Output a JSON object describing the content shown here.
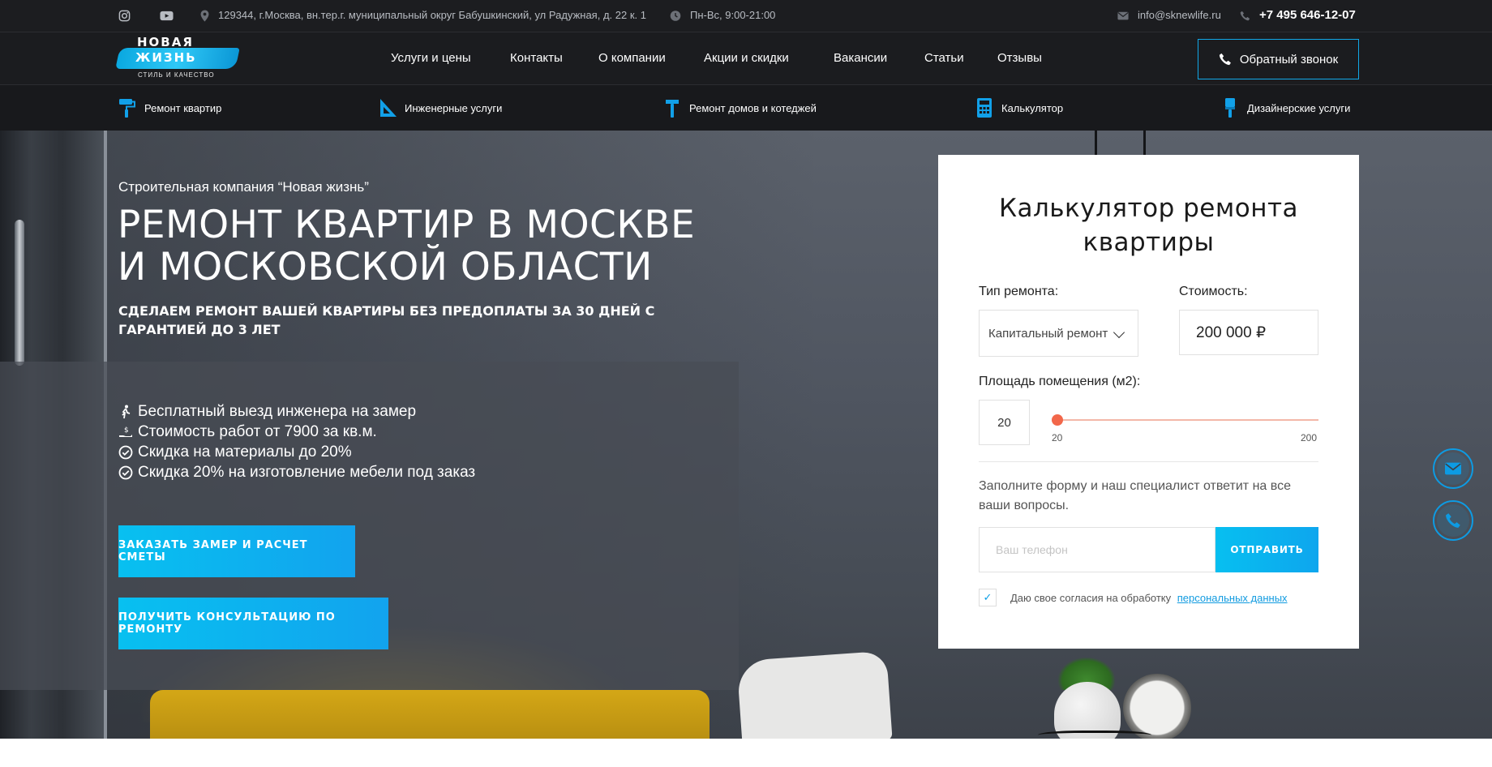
{
  "topbar": {
    "address": "129344, г.Москва, вн.тер.г. муниципальный округ Бабушкинский, ул Радужная, д. 22 к. 1",
    "hours": "Пн-Вс, 9:00-21:00",
    "email": "info@sknewlife.ru",
    "phone": "+7 495 646-12-07",
    "icons": [
      "instagram-icon",
      "youtube-icon",
      "location-icon",
      "clock-icon",
      "mail-icon",
      "phone-icon"
    ]
  },
  "logo": {
    "line1": "НОВАЯ",
    "line2": "ЖИЗНЬ",
    "tagline": "СТИЛЬ И КАЧЕСТВО"
  },
  "nav": {
    "items": [
      "Услуги и цены",
      "Контакты",
      "О компании",
      "Акции и скидки",
      "Вакансии",
      "Статьи",
      "Отзывы"
    ],
    "callback": "Обратный звонок"
  },
  "categories": [
    {
      "label": "Ремонт квартир",
      "icon": "paint-roller-icon"
    },
    {
      "label": "Инженерные услуги",
      "icon": "ruler-triangle-icon"
    },
    {
      "label": "Ремонт домов и котеджей",
      "icon": "hammer-icon"
    },
    {
      "label": "Калькулятор",
      "icon": "calculator-icon"
    },
    {
      "label": "Дизайнерские услуги",
      "icon": "paint-brush-icon"
    }
  ],
  "hero": {
    "subtitle": "Строительная компания “Новая жизнь”",
    "title_line1": "РЕМОНТ КВАРТИР В МОСКВЕ",
    "title_line2": "И МОСКОВСКОЙ ОБЛАСТИ",
    "tagline": "СДЕЛАЕМ РЕМОНТ ВАШЕЙ КВАРТИРЫ БЕЗ ПРЕДОПЛАТЫ ЗА 30 ДНЕЙ С ГАРАНТИЕЙ ДО 3 ЛЕТ",
    "features": [
      "Бесплатный выезд инженера на замер",
      "Стоимость работ от 7900 за кв.м.",
      "Скидка на материалы до 20%",
      "Скидка 20% на изготовление мебели под заказ"
    ],
    "btn_measure": "ЗАКАЗАТЬ ЗАМЕР И РАСЧЕТ СМЕТЫ",
    "btn_consult": "ПОЛУЧИТЬ КОНСУЛЬТАЦИЮ ПО РЕМОНТУ"
  },
  "calculator": {
    "title_line1": "Калькулятор ремонта",
    "title_line2": "квартиры",
    "type_label": "Тип ремонта:",
    "type_value": "Капитальный ремонт",
    "cost_label": "Стоимость:",
    "cost_value": "200 000 ₽",
    "area_label": "Площадь помещения (м2):",
    "area_value": "20",
    "slider_min": "20",
    "slider_max": "200",
    "slider_fraction": 0,
    "note": "Заполните форму и наш специалист ответит на все ваши вопросы.",
    "phone_placeholder": "Ваш телефон",
    "send": "ОТПРАВИТЬ",
    "consent_text": "Даю свое согласия на обработку",
    "consent_link": "персональных данных",
    "consent_check": "✓"
  },
  "colors": {
    "accent": "#0aa8e8",
    "slider": "#f2674a",
    "dark": "#1b1c1f"
  }
}
